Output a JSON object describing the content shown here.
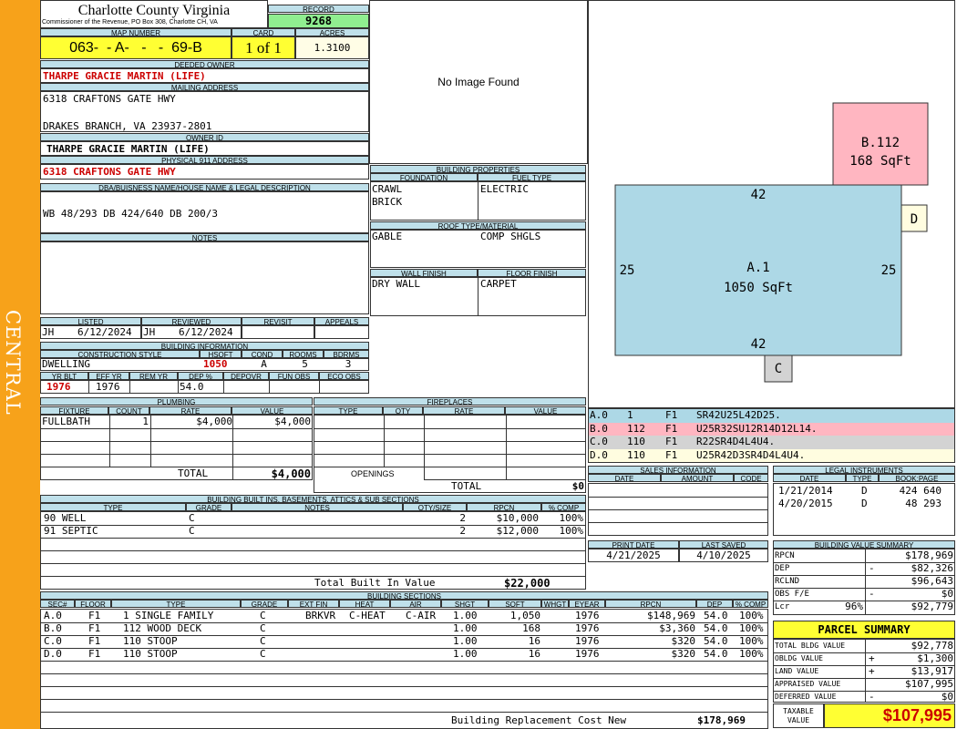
{
  "sidebar": {
    "label": "CENTRAL"
  },
  "header": {
    "county": "Charlotte County Virginia",
    "commissioner": "Commissioner of the Revenue, PO Box 308, Charlotte CH, VA",
    "record_label": "RECORD",
    "record": "9268",
    "map_label": "MAP NUMBER",
    "map": "063-  - A-   -   -  69-B",
    "card_label": "CARD",
    "card": "1 of 1",
    "acres_label": "ACRES",
    "acres": "1.3100"
  },
  "owner": {
    "deeded_label": "DEEDED OWNER",
    "deeded": "THARPE GRACIE MARTIN (LIFE)",
    "mailing_label": "MAILING ADDRESS",
    "mail1": "6318 CRAFTONS GATE HWY",
    "mail2": "DRAKES BRANCH, VA 23937-2801",
    "ownerid_label": "OWNER ID",
    "ownerid": "THARPE GRACIE MARTIN (LIFE)",
    "physical_label": "PHYSICAL 911 ADDRESS",
    "physical": "6318 CRAFTONS GATE HWY",
    "dba_label": "DBA/BUISNESS NAME/HOUSE NAME & LEGAL DESCRIPTION",
    "legal": "WB 48/293 DB 424/640 DB 200/3",
    "notes_label": "NOTES"
  },
  "image": {
    "none": "No Image Found"
  },
  "listing": {
    "listed_label": "LISTED",
    "reviewed_label": "REVIEWED",
    "revisit_label": "REVISIT",
    "appeals_label": "APPEALS",
    "listed_by": "JH",
    "listed_date": "6/12/2024",
    "reviewed_by": "JH",
    "reviewed_date": "6/12/2024"
  },
  "building_info": {
    "title": "BUILDING INFORMATION",
    "style_label": "CONSTRUCTION STYLE",
    "hsqft_label": "HSQFT",
    "cond_label": "COND",
    "rooms_label": "ROOMS",
    "bdrms_label": "BDRMS",
    "style": "DWELLING",
    "hsqft": "1050",
    "cond": "A",
    "rooms": "5",
    "bdrms": "3",
    "yrblt_label": "YR BLT",
    "effyr_label": "EFF YR",
    "remyr_label": "REM YR",
    "dep_label": "DEP %",
    "depovr_label": "DEPOVR",
    "funobs_label": "FUN OBS",
    "ecoobs_label": "ECO OBS",
    "yrblt": "1976",
    "effyr": "1976",
    "dep": "54.0"
  },
  "plumbing": {
    "title": "PLUMBING",
    "h_fixture": "FIXTURE",
    "h_count": "COUNT",
    "h_rate": "RATE",
    "h_value": "VALUE",
    "fixture": "FULLBATH",
    "count": "1",
    "rate": "$4,000",
    "value": "$4,000",
    "total_label": "TOTAL",
    "total": "$4,000"
  },
  "fireplaces": {
    "title": "FIREPLACES",
    "h_type": "TYPE",
    "h_qty": "QTY",
    "h_rate": "RATE",
    "h_value": "VALUE",
    "openings": "OPENINGS",
    "total_label": "TOTAL",
    "total": "$0"
  },
  "props": {
    "title": "BUILDING PROPERTIES",
    "foundation_label": "FOUNDATION",
    "fuel_label": "FUEL TYPE",
    "foundation1": "CRAWL",
    "foundation2": "BRICK",
    "fuel": "ELECTRIC",
    "roof_label": "ROOF TYPE/MATERIAL",
    "roof_type": "GABLE",
    "roof_mat": "COMP SHGLS",
    "wall_label": "WALL FINISH",
    "floor_label": "FLOOR FINISH",
    "wall": "DRY WALL",
    "floor": "CARPET"
  },
  "builtins": {
    "title": "BUILDING BUILT INS, BASEMENTS, ATTICS & SUB SECTIONS",
    "h_type": "TYPE",
    "h_grade": "GRADE",
    "h_notes": "NOTES",
    "h_qty": "QTY/SIZE",
    "h_rpcn": "RPCN",
    "h_comp": "% COMP",
    "rows": [
      {
        "type": "90 WELL",
        "grade": "C",
        "qty": "2",
        "rpcn": "$10,000",
        "comp": "100%"
      },
      {
        "type": "91 SEPTIC",
        "grade": "C",
        "qty": "2",
        "rpcn": "$12,000",
        "comp": "100%"
      }
    ],
    "total_label": "Total Built In Value",
    "total": "$22,000"
  },
  "sections": {
    "title": "BUILDING SECTIONS",
    "headers": [
      "SEC#",
      "FLOOR",
      "TYPE",
      "GRADE",
      "EXT FIN",
      "HEAT",
      "AIR",
      "SHGT",
      "SQFT",
      "WHGT",
      "EYEAR",
      "RPCN",
      "DEP",
      "% COMP"
    ],
    "rows": [
      {
        "sec": "A.0",
        "floor": "F1",
        "type": "1 SINGLE FAMILY",
        "grade": "C",
        "ext": "BRKVR",
        "heat": "C-HEAT",
        "air": "C-AIR",
        "shgt": "1.00",
        "sqft": "1,050",
        "eyear": "1976",
        "rpcn": "$148,969",
        "dep": "54.0",
        "comp": "100%"
      },
      {
        "sec": "B.0",
        "floor": "F1",
        "type": "112 WOOD DECK",
        "grade": "C",
        "ext": "",
        "heat": "",
        "air": "",
        "shgt": "1.00",
        "sqft": "168",
        "eyear": "1976",
        "rpcn": "$3,360",
        "dep": "54.0",
        "comp": "100%"
      },
      {
        "sec": "C.0",
        "floor": "F1",
        "type": "110 STOOP",
        "grade": "C",
        "ext": "",
        "heat": "",
        "air": "",
        "shgt": "1.00",
        "sqft": "16",
        "eyear": "1976",
        "rpcn": "$320",
        "dep": "54.0",
        "comp": "100%"
      },
      {
        "sec": "D.0",
        "floor": "F1",
        "type": "110 STOOP",
        "grade": "C",
        "ext": "",
        "heat": "",
        "air": "",
        "shgt": "1.00",
        "sqft": "16",
        "eyear": "1976",
        "rpcn": "$320",
        "dep": "54.0",
        "comp": "100%"
      }
    ],
    "replacement_label": "Building Replacement Cost New",
    "replacement": "$178,969"
  },
  "sketch": {
    "a_label": "A.1",
    "a_area": "1050 SqFt",
    "b_label": "B.112",
    "b_area": "168 SqFt",
    "c_label": "C",
    "d_label": "D",
    "top": "42",
    "bottom": "42",
    "left": "25",
    "right": "25",
    "colors": {
      "a": "#add8e6",
      "b": "#ffb6c1",
      "c": "#d3d3d3",
      "d": "#fffde0"
    }
  },
  "segments": [
    {
      "sec": "A.0",
      "code": "1",
      "fl": "F1",
      "path": "SR42U25L42D25."
    },
    {
      "sec": "B.0",
      "code": "112",
      "fl": "F1",
      "path": "U25R32SU12R14D12L14."
    },
    {
      "sec": "C.0",
      "code": "110",
      "fl": "F1",
      "path": "R22SR4D4L4U4."
    },
    {
      "sec": "D.0",
      "code": "110",
      "fl": "F1",
      "path": "U25R42D3SR4D4L4U4."
    }
  ],
  "sales": {
    "title": "SALES INFORMATION",
    "h_date": "DATE",
    "h_amount": "AMOUNT",
    "h_code": "CODE"
  },
  "legal": {
    "title": "LEGAL INSTRUMENTS",
    "h_date": "DATE",
    "h_type": "TYPE",
    "h_book": "BOOK:PAGE",
    "rows": [
      {
        "date": "1/21/2014",
        "type": "D",
        "book": "424 640"
      },
      {
        "date": "4/20/2015",
        "type": "D",
        "book": "48 293"
      }
    ]
  },
  "dates": {
    "print_label": "PRINT DATE",
    "saved_label": "LAST SAVED",
    "print": "4/21/2025",
    "saved": "4/10/2025"
  },
  "value_summary": {
    "title": "BUILDING VALUE SUMMARY",
    "rows": [
      {
        "label": "RPCN",
        "sign": "",
        "value": "$178,969"
      },
      {
        "label": "DEP",
        "sign": "-",
        "value": "$82,326"
      },
      {
        "label": "RCLND",
        "sign": "",
        "value": "$96,643"
      },
      {
        "label": "OBS F/E",
        "sign": "-",
        "value": "$0"
      },
      {
        "label": "Lcr",
        "pct": "96%",
        "sign": "",
        "value": "$92,779"
      }
    ]
  },
  "parcel": {
    "title": "PARCEL SUMMARY",
    "rows": [
      {
        "label": "TOTAL BLDG VALUE",
        "sign": "",
        "value": "$92,778"
      },
      {
        "label": "OBLDG VALUE",
        "sign": "+",
        "value": "$1,300"
      },
      {
        "label": "LAND VALUE",
        "sign": "+",
        "value": "$13,917"
      },
      {
        "label": "APPRAISED VALUE",
        "sign": "",
        "value": "$107,995"
      },
      {
        "label": "DEFERRED VALUE",
        "sign": "-",
        "value": "$0"
      }
    ],
    "taxable_label1": "TAXABLE",
    "taxable_label2": "VALUE",
    "taxable": "$107,995"
  }
}
